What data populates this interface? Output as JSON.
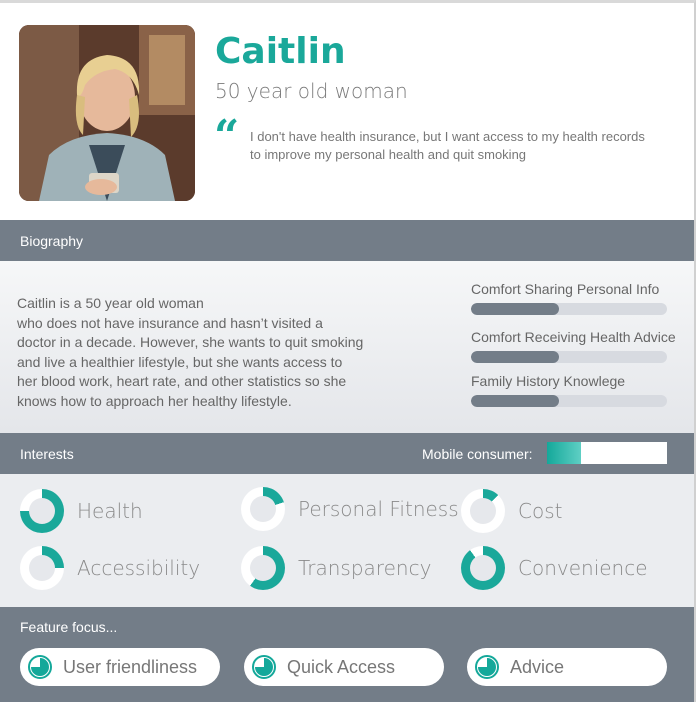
{
  "profile": {
    "name": "Caitlin",
    "subtitle": "50 year old woman",
    "quote_mark": "“",
    "quote": "I don't have health insurance, but I want access to my health records to improve my personal health and quit smoking"
  },
  "biography": {
    "heading": "Biography",
    "text": "Caitlin  is a 50 year old woman\nwho does not have insurance and hasn’t visited a\ndoctor in a decade. However, she wants to quit smoking\n and live a healthier lifestyle, but she wants access to\n her blood work, heart rate, and other statistics so she\n knows how to approach her healthy lifestyle.",
    "metrics": [
      {
        "label": "Comfort Sharing Personal Info",
        "level": 0.45
      },
      {
        "label": "Comfort Receiving Health Advice",
        "level": 0.45
      },
      {
        "label": "Family History Knowlege",
        "level": 0.45
      }
    ]
  },
  "interests": {
    "heading": "Interests",
    "mobile_label": "Mobile consumer:",
    "mobile_level": 0.28,
    "items": [
      {
        "label": "Health",
        "level": 0.75
      },
      {
        "label": "Personal Fitness",
        "level": 0.2
      },
      {
        "label": "Cost",
        "level": 0.12
      },
      {
        "label": "Accessibility",
        "level": 0.25
      },
      {
        "label": "Transparency",
        "level": 0.6
      },
      {
        "label": "Convenience",
        "level": 0.9
      }
    ]
  },
  "features": {
    "heading": "Feature focus...",
    "items": [
      {
        "label": "User friendliness",
        "icon": "pie-quarter-icon"
      },
      {
        "label": "Quick Access",
        "icon": "pie-quarter-icon"
      },
      {
        "label": "Advice",
        "icon": "pie-quarter-icon"
      }
    ]
  },
  "colors": {
    "accent": "#1aa89a",
    "band": "#737d88",
    "track": "#d7dae0"
  }
}
